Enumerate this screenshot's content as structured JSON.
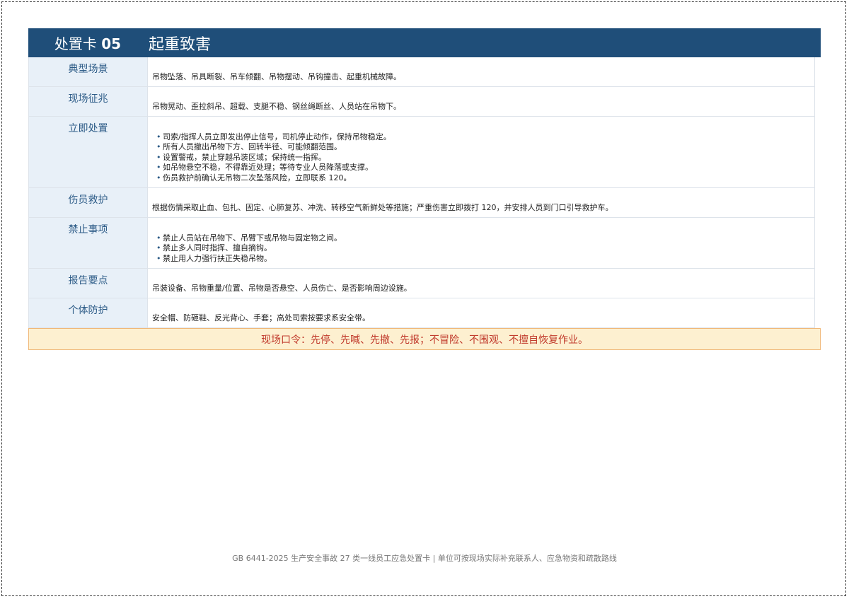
{
  "card": {
    "number_prefix": "处置卡",
    "number": "05",
    "title": "起重致害"
  },
  "rows": [
    {
      "label": "典型场景",
      "text": "吊物坠落、吊具断裂、吊车倾翻、吊物摆动、吊钩撞击、起重机械故障。"
    },
    {
      "label": "现场征兆",
      "text": "吊物晃动、歪拉斜吊、超载、支腿不稳、钢丝绳断丝、人员站在吊物下。"
    },
    {
      "label": "立即处置",
      "items": [
        "司索/指挥人员立即发出停止信号，司机停止动作，保持吊物稳定。",
        "所有人员撤出吊物下方、回转半径、可能倾翻范围。",
        "设置警戒，禁止穿越吊装区域；保持统一指挥。",
        "如吊物悬空不稳，不得靠近处理；等待专业人员降落或支撑。",
        "伤员救护前确认无吊物二次坠落风险，立即联系 120。"
      ]
    },
    {
      "label": "伤员救护",
      "text": "根据伤情采取止血、包扎、固定、心肺复苏、冲洗、转移空气新鲜处等措施；严重伤害立即拨打 120，并安排人员到门口引导救护车。"
    },
    {
      "label": "禁止事项",
      "items": [
        "禁止人员站在吊物下、吊臂下或吊物与固定物之间。",
        "禁止多人同时指挥、擅自摘钩。",
        "禁止用人力强行扶正失稳吊物。"
      ]
    },
    {
      "label": "报告要点",
      "text": "吊装设备、吊物重量/位置、吊物是否悬空、人员伤亡、是否影响周边设施。"
    },
    {
      "label": "个体防护",
      "text": "安全帽、防砸鞋、反光背心、手套；高处司索按要求系安全带。"
    }
  ],
  "slogan": "现场口令：先停、先喊、先撤、先报；不冒险、不围观、不擅自恢复作业。",
  "footer": "GB 6441-2025 生产安全事故 27 类一线员工应急处置卡 | 单位可按现场实际补充联系人、应急物资和疏散路线",
  "colors": {
    "header_bg": "#1f4e79",
    "label_bg": "#e8f0f8",
    "label_text": "#2b5a86",
    "slogan_bg": "#fdf0d0",
    "slogan_border": "#f0b878",
    "slogan_text": "#c0392b"
  }
}
